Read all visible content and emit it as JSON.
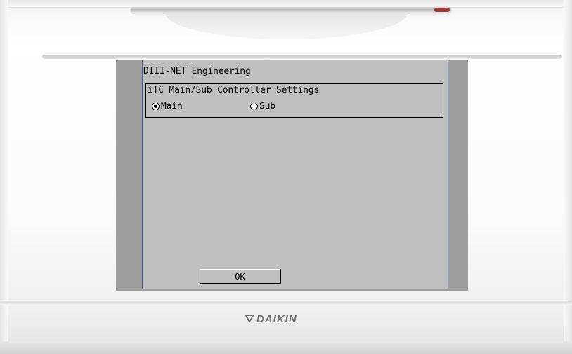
{
  "screen": {
    "title": "DIII-NET Engineering",
    "group_title": "iTC Main/Sub Controller Settings",
    "options": [
      {
        "label": "Main",
        "selected": true
      },
      {
        "label": "Sub",
        "selected": false
      }
    ],
    "ok_label": "OK"
  },
  "device": {
    "brand": "DAIKIN"
  },
  "colors": {
    "screen_bg": "#c0c0c0",
    "screen_border": "#4a56a0",
    "screen_outer": "#9e9e9e",
    "logo": "#6a6f78"
  }
}
